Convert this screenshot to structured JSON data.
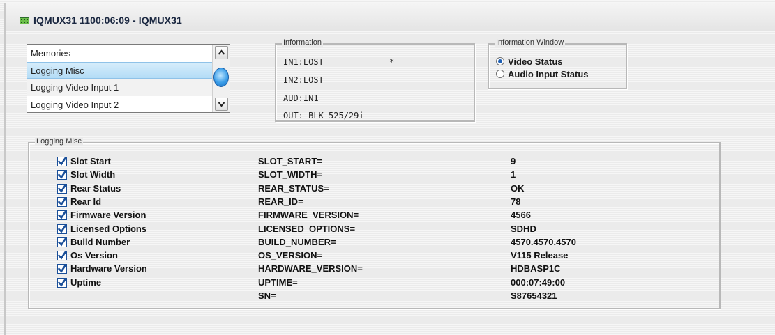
{
  "window": {
    "title": "IQMUX31  1100:06:09  - IQMUX31",
    "icon": "module-icon"
  },
  "memories_list": {
    "items": [
      {
        "label": "Memories",
        "selected": false
      },
      {
        "label": "Logging Misc",
        "selected": true
      },
      {
        "label": "Logging Video Input 1",
        "selected": false
      },
      {
        "label": "Logging Video Input 2",
        "selected": false
      }
    ]
  },
  "information": {
    "legend": "Information",
    "lines": [
      "IN1:LOST",
      "IN2:LOST",
      "AUD:IN1",
      "OUT: BLK 525/29i"
    ],
    "marker": "*"
  },
  "information_window": {
    "legend": "Information Window",
    "options": [
      {
        "label": "Video Status",
        "checked": true
      },
      {
        "label": "Audio Input Status",
        "checked": false
      }
    ]
  },
  "logging_misc": {
    "legend": "Logging Misc",
    "rows": [
      {
        "label": "Slot Start",
        "key": "SLOT_START=",
        "value": "9",
        "checked": true
      },
      {
        "label": "Slot Width",
        "key": "SLOT_WIDTH=",
        "value": "1",
        "checked": true
      },
      {
        "label": "Rear Status",
        "key": "REAR_STATUS=",
        "value": "OK",
        "checked": true
      },
      {
        "label": "Rear Id",
        "key": "REAR_ID=",
        "value": "78",
        "checked": true
      },
      {
        "label": "Firmware Version",
        "key": "FIRMWARE_VERSION=",
        "value": "4566",
        "checked": true
      },
      {
        "label": "Licensed Options",
        "key": "LICENSED_OPTIONS=",
        "value": "SDHD",
        "checked": true
      },
      {
        "label": "Build Number",
        "key": "BUILD_NUMBER=",
        "value": "4570.4570.4570",
        "checked": true
      },
      {
        "label": "Os Version",
        "key": "OS_VERSION=",
        "value": "V115 Release",
        "checked": true
      },
      {
        "label": "Hardware Version",
        "key": "HARDWARE_VERSION=",
        "value": "HDBASP1C",
        "checked": true
      },
      {
        "label": "Uptime",
        "key": "UPTIME=",
        "value": "000:07:49:00",
        "checked": true
      }
    ],
    "sn_key": "SN=",
    "sn_value": "S87654321"
  }
}
